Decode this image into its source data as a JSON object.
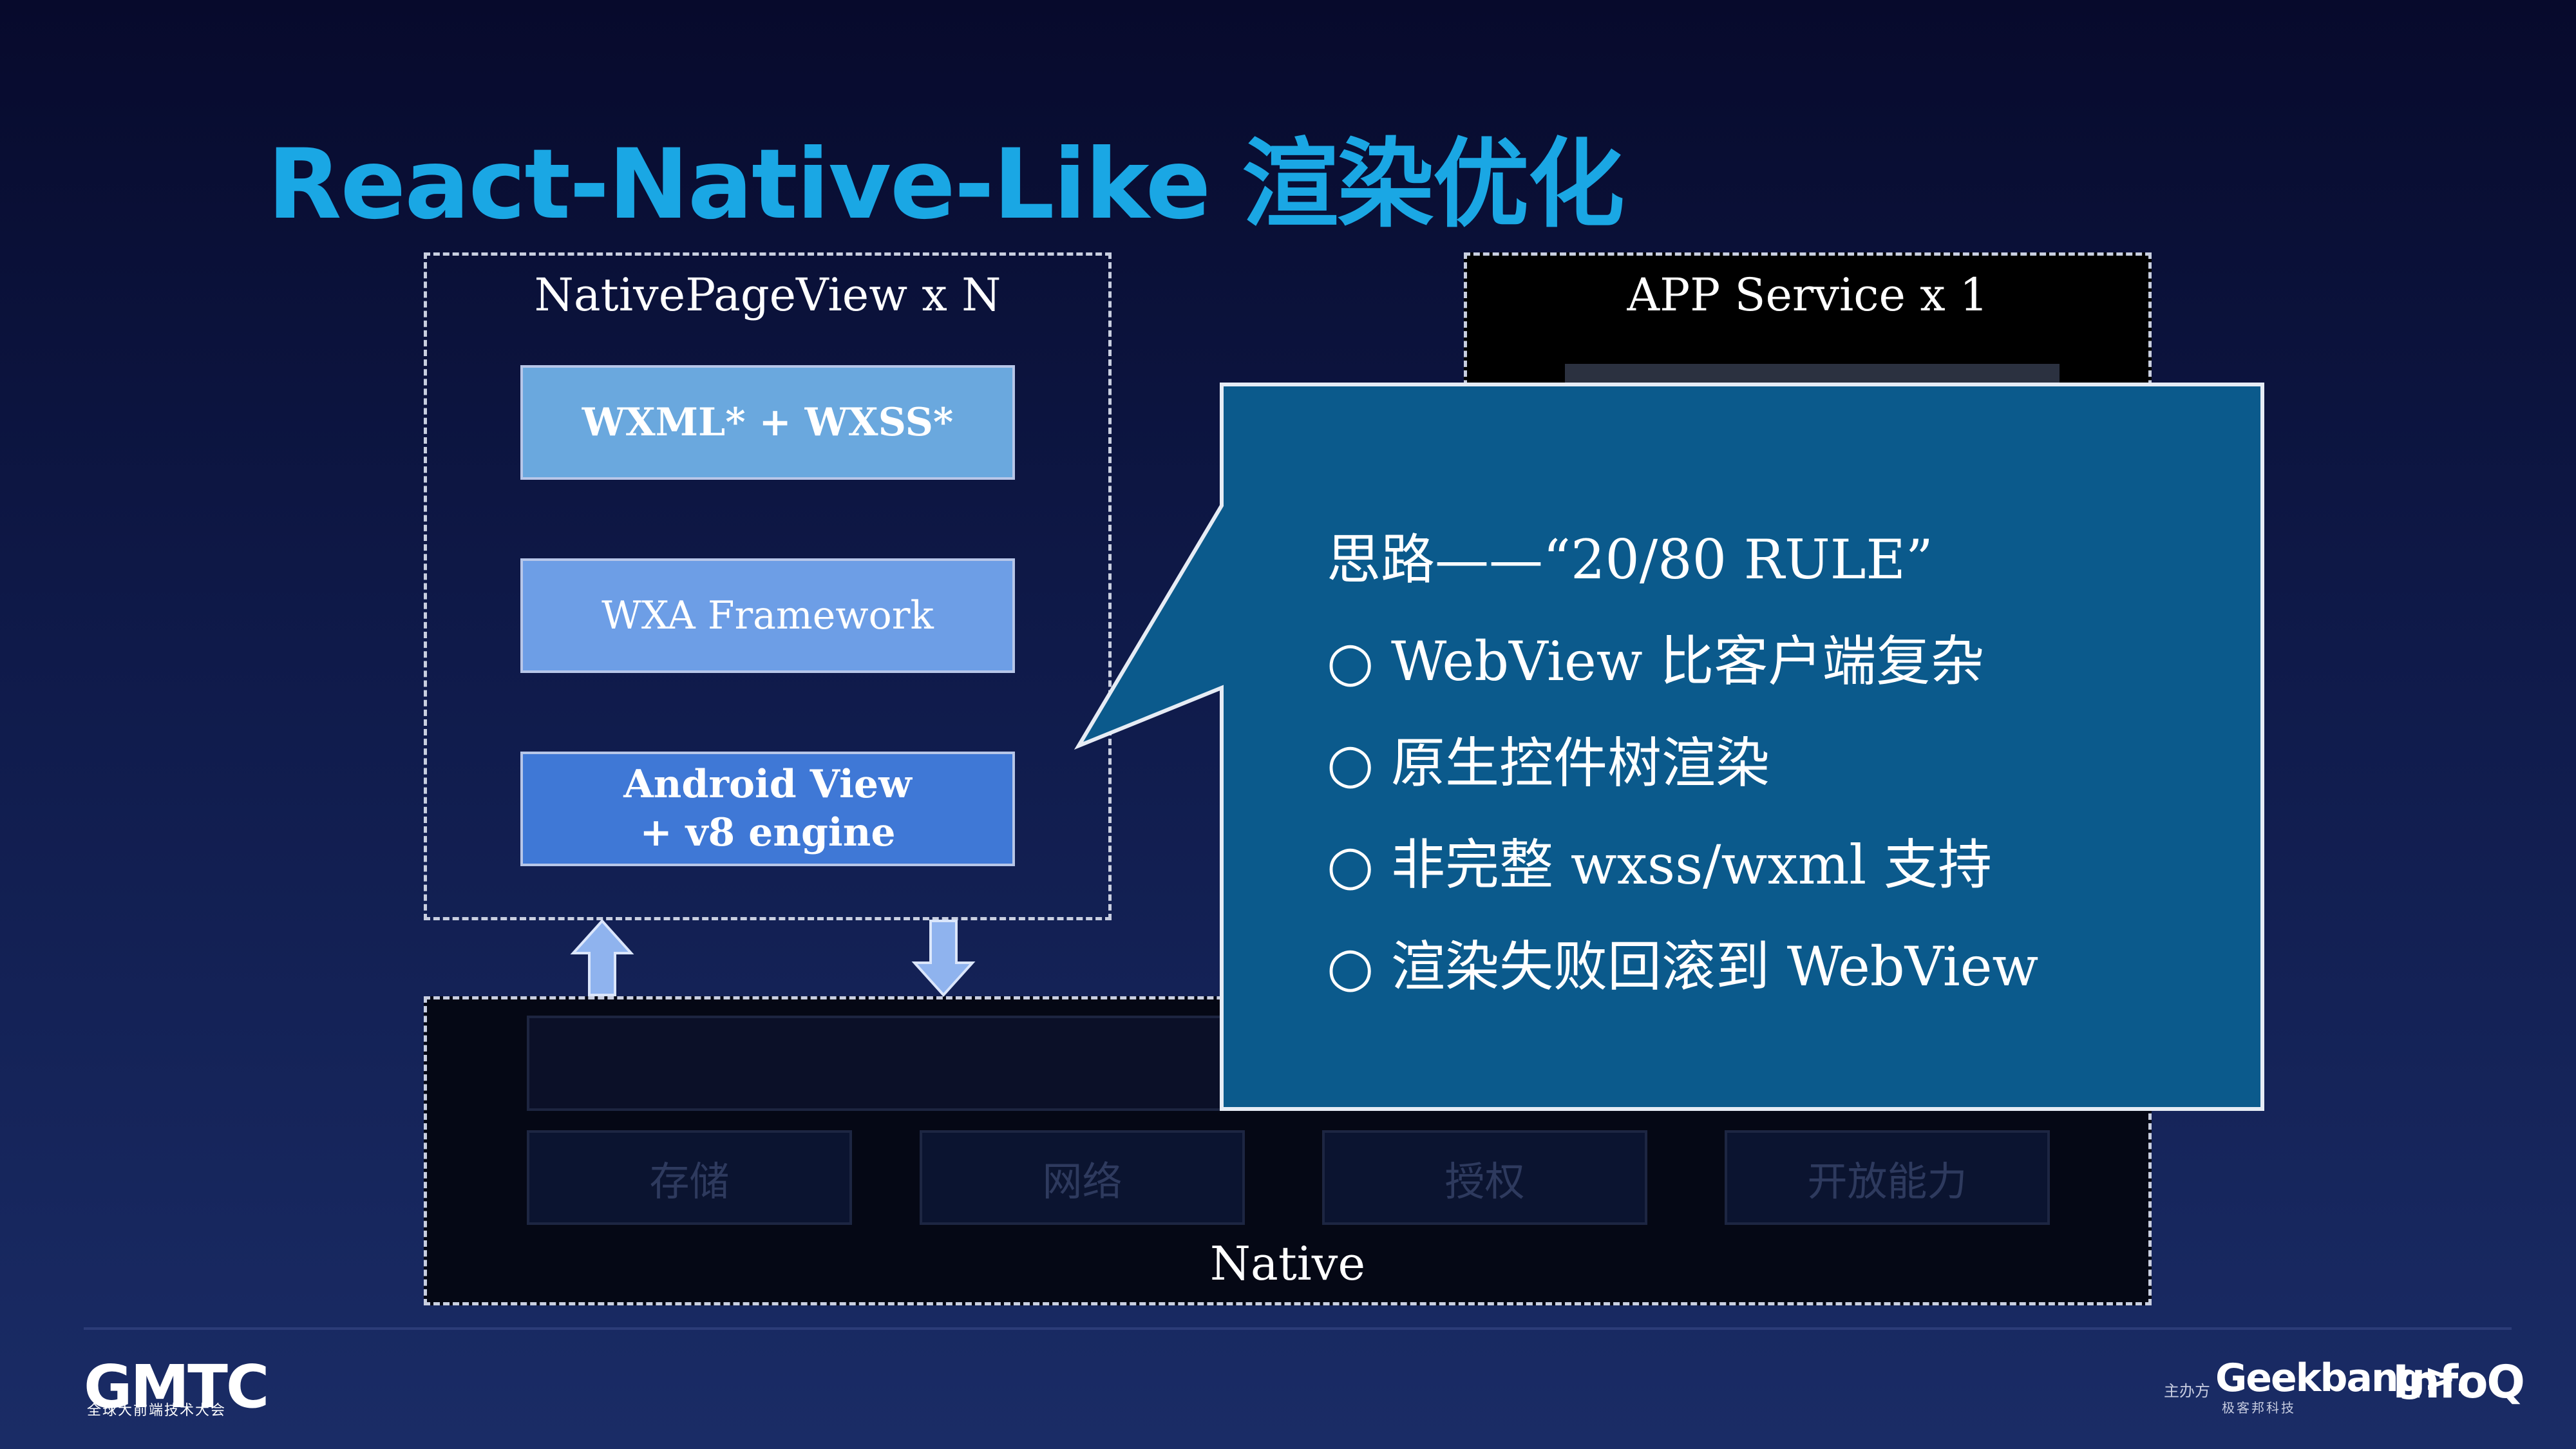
{
  "slide": {
    "title": "React-Native-Like 渲染优化"
  },
  "left_panel": {
    "title": "NativePageView x N",
    "layers": {
      "wxml": "WXML* + WXSS*",
      "framework": "WXA Framework",
      "android_line1": "Android View",
      "android_line2": "+ v8 engine"
    }
  },
  "right_panel": {
    "title": "APP Service x 1"
  },
  "native_panel": {
    "label": "Native",
    "capabilities": [
      "存储",
      "网络",
      "授权",
      "开放能力"
    ]
  },
  "callout": {
    "heading": "思路——“20/80 RULE”",
    "bullets": [
      "○ WebView 比客户端复杂",
      "○ 原生控件树渲染",
      "○ 非完整 wxss/wxml 支持",
      "○ 渲染失败回滚到 WebView"
    ]
  },
  "footer": {
    "brand": "GMTC",
    "brand_sub": "全球大前端技术大会",
    "sponsor_label": "主办方",
    "geekbang": "Geekbang>.",
    "geekbang_sub": "极客邦科技",
    "infoq": "InfoQ"
  },
  "colors": {
    "title": "#1aa7e4",
    "callout_bg": "#0b5a8c",
    "arrow": "#8fb3ee"
  }
}
